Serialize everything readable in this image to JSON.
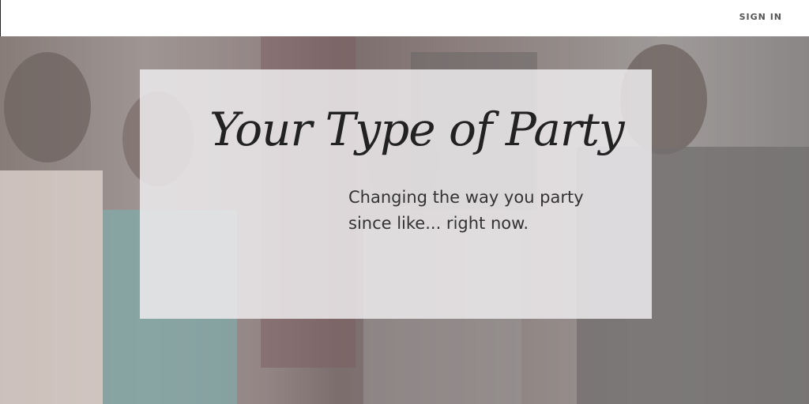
{
  "header": {
    "signin_label": "SIGN IN"
  },
  "hero": {
    "title": "Your Type of Party",
    "tagline_line1": "Changing the way you party",
    "tagline_line2": "since like... right now."
  },
  "colors": {
    "header_bg": "#ffffff",
    "signin_text": "#555555",
    "card_bg": "#ecebec",
    "title_text": "#222222"
  }
}
